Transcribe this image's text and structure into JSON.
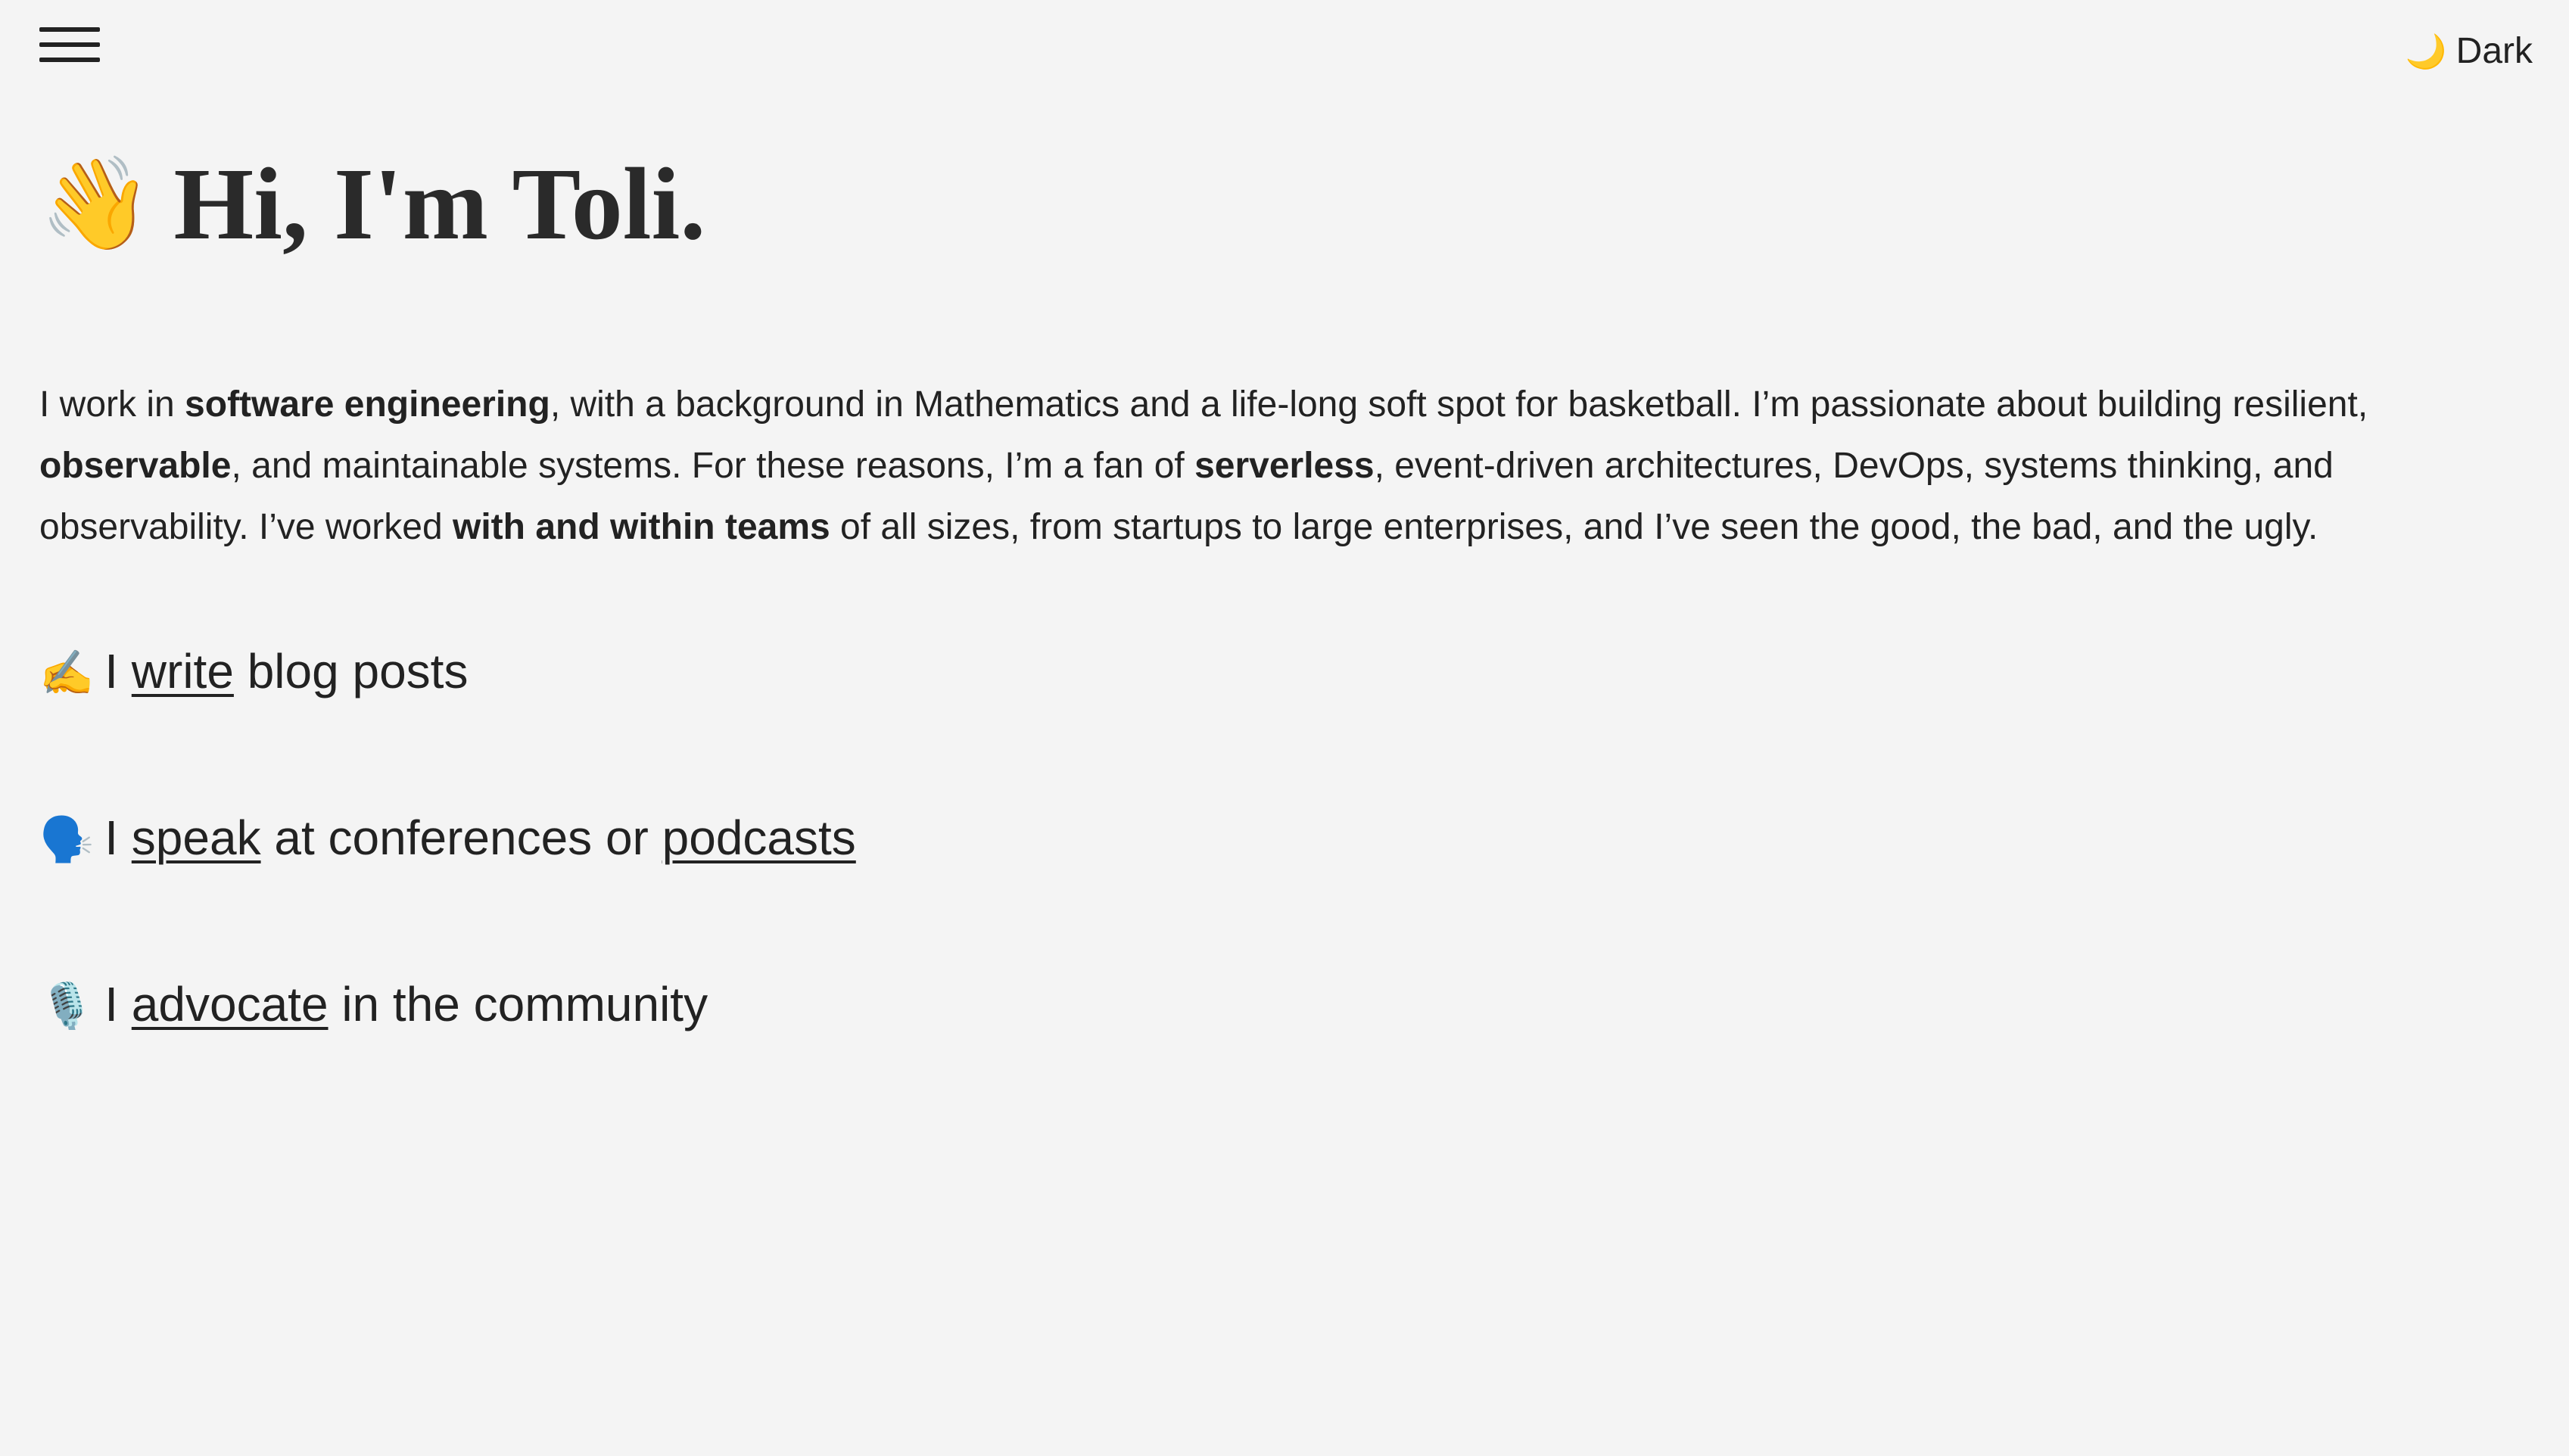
{
  "nav": {
    "menu_icon": "hamburger-menu-icon",
    "theme_toggle": {
      "icon": "crescent-moon-icon",
      "icon_glyph": "🌙",
      "label": "Dark"
    }
  },
  "hero": {
    "icon_glyph": "👋",
    "title": "Hi, I'm Toli."
  },
  "intro": {
    "t1": "I work in ",
    "b1": "software engineering",
    "t2": ", with a background in Mathematics and a life-long soft spot for basketball. I’m passionate about building resilient, ",
    "b2": "observable",
    "t3": ", and maintainable systems. For these reasons, I’m a fan of ",
    "b3": "serverless",
    "t4": ", event-driven architectures, DevOps, systems thinking, and observability. I’ve worked ",
    "b4": "with and within teams",
    "t5": " of all sizes, from startups to large enterprises, and I’ve seen the good, the bad, and the ugly."
  },
  "items": {
    "write": {
      "icon_glyph": "✍️",
      "pre": "I ",
      "link": "write",
      "post": " blog posts"
    },
    "speak": {
      "icon_glyph": "🗣️",
      "pre": "I ",
      "link": "speak",
      "mid": " at conferences or ",
      "link2": "podcasts"
    },
    "advocate": {
      "icon_glyph": "🎙️",
      "pre": "I ",
      "link": "advocate",
      "post": " in the community"
    }
  }
}
